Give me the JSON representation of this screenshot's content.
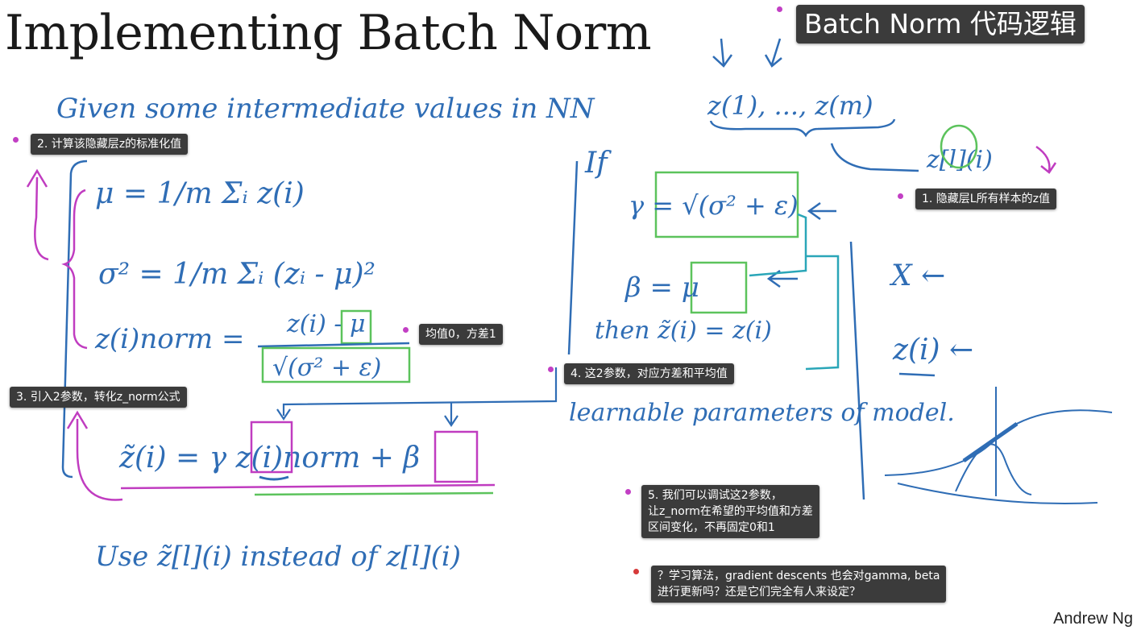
{
  "slide": {
    "title": "Implementing Batch Norm",
    "author": "Andrew Ng"
  },
  "handwriting": {
    "given": "Given some intermediate values in NN",
    "z_sequence": "z(1), ..., z(m)",
    "z_layer_index": "z[l](i)",
    "mu": "μ = 1/m Σᵢ z(i)",
    "sigma": "σ² = 1/m Σᵢ (zᵢ - μ)²",
    "znorm_lhs": "z(i)norm =",
    "znorm_num": "z(i) - μ",
    "znorm_den": "√(σ² + ε)",
    "ztilde": "z̃(i) = γ z(i)norm + β",
    "if": "If",
    "gamma_eq": "γ = √(σ² + ε)",
    "beta_eq": "β = μ",
    "then": "then z̃(i) = z(i)",
    "learnable": "learnable parameters of model.",
    "use": "Use z̃[l](i) instead of z[l](i)",
    "x_arrow": "X ←",
    "z_arrow": "z(i) ←"
  },
  "annotations": [
    {
      "id": "header",
      "text": "Batch Norm 代码逻辑"
    },
    {
      "id": "note1",
      "text": "1. 隐藏层L所有样本的z值"
    },
    {
      "id": "note2",
      "text": "2. 计算该隐藏层z的标准化值"
    },
    {
      "id": "note3",
      "text": "3. 引入2参数，转化z_norm公式"
    },
    {
      "id": "note4",
      "text": "4. 这2参数，对应方差和平均值"
    },
    {
      "id": "note5",
      "lines": [
        "5. 我们可以调试这2参数，",
        "让z_norm在希望的平均值和方差",
        "区间变化，不再固定0和1"
      ]
    },
    {
      "id": "note_mean",
      "text": "均值0，方差1"
    },
    {
      "id": "question",
      "lines": [
        "？学习算法，gradient descents 也会对gamma, beta",
        "进行更新吗？还是它们完全有人来设定？"
      ]
    }
  ],
  "colors": {
    "ink_blue": "#2f6db5",
    "ink_magenta": "#c03cc0",
    "ink_green": "#5cc35c",
    "ink_teal": "#2aa6b8",
    "note_bg": "#3b3b3b",
    "marker_dot": "#c23fc4",
    "question_dot": "#d63a3a"
  }
}
